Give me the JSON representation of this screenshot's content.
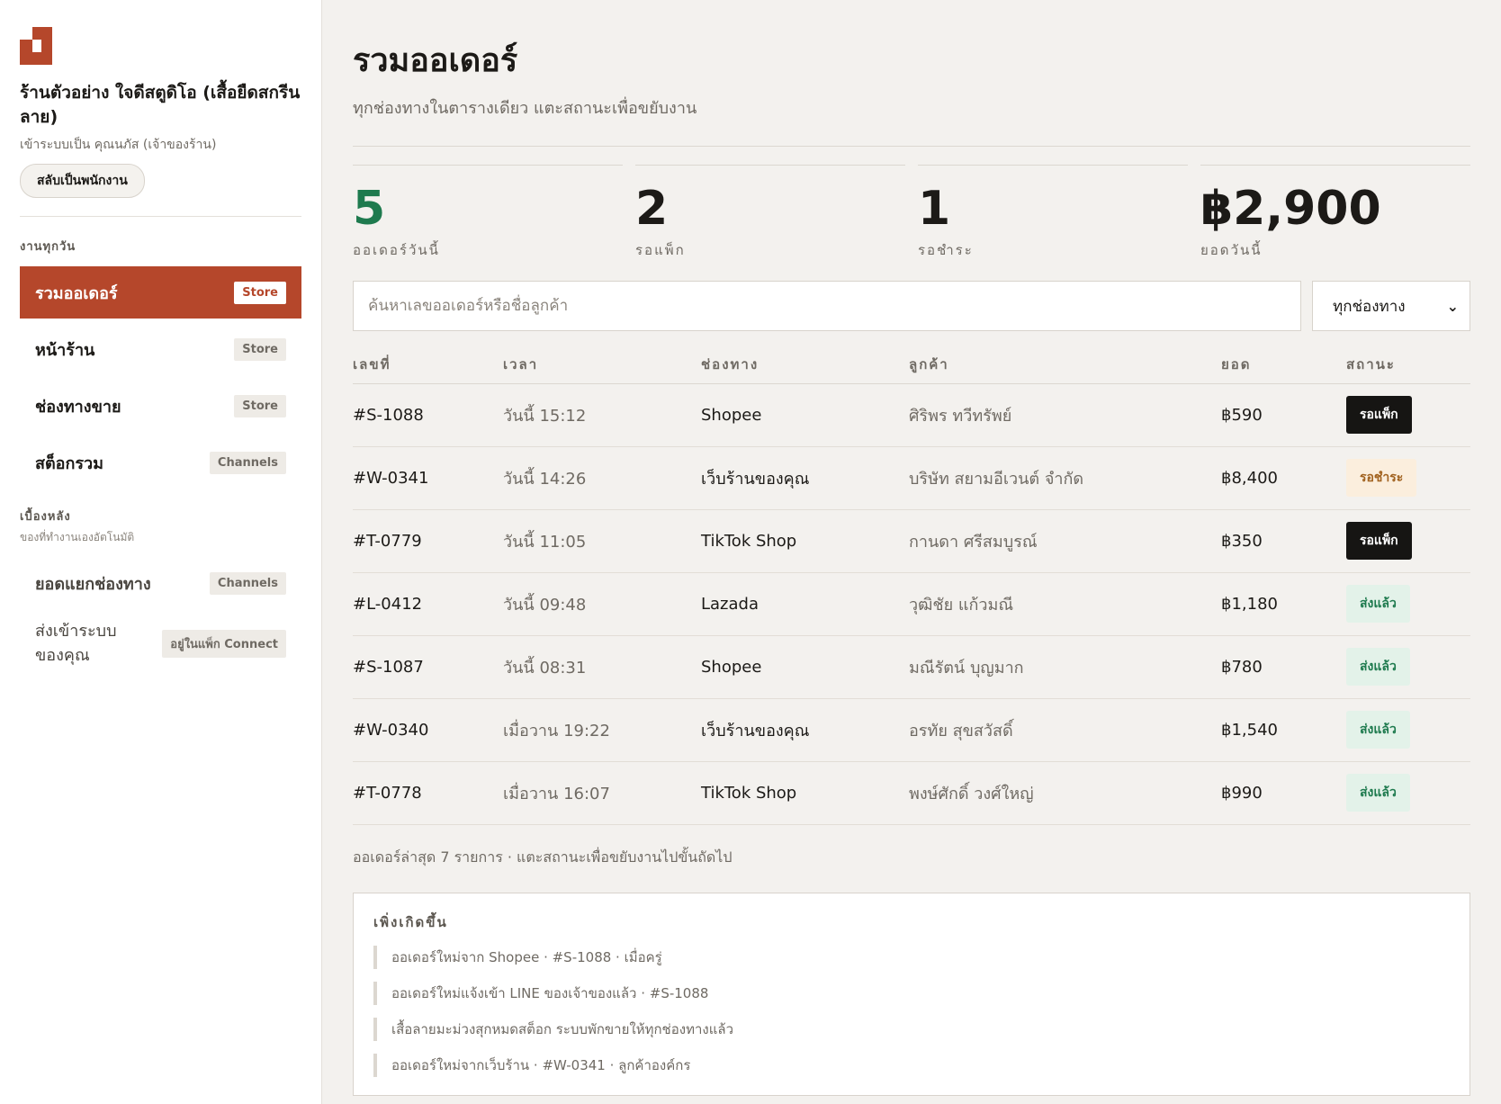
{
  "shop": {
    "name": "ร้านตัวอย่าง ใจดีสตูดิโอ (เสื้อยืดสกรีนลาย)",
    "login_as": "เข้าระบบเป็น คุณนภัส (เจ้าของร้าน)",
    "switch_label": "สลับเป็นพนักงาน"
  },
  "sidebar": {
    "section_daily": "งานทุกวัน",
    "daily_items": [
      {
        "label": "รวมออเดอร์",
        "tag": "Store"
      },
      {
        "label": "หน้าร้าน",
        "tag": "Store"
      },
      {
        "label": "ช่องทางขาย",
        "tag": "Store"
      },
      {
        "label": "สต็อกรวม",
        "tag": "Channels"
      }
    ],
    "section_back": "เบื้องหลัง",
    "section_back_sub": "ของที่ทำงานเองอัตโนมัติ",
    "back_items": [
      {
        "label": "ยอดแยกช่องทาง",
        "tag": "Channels"
      },
      {
        "label": "ส่งเข้าระบบของคุณ",
        "tag": "อยู่ในแพ็ก Connect"
      }
    ]
  },
  "header": {
    "title": "รวมออเดอร์",
    "subtitle": "ทุกช่องทางในตารางเดียว แตะสถานะเพื่อขยับงาน"
  },
  "stats": [
    {
      "value": "5",
      "label": "ออเดอร์วันนี้"
    },
    {
      "value": "2",
      "label": "รอแพ็ก"
    },
    {
      "value": "1",
      "label": "รอชำระ"
    },
    {
      "value": "฿2,900",
      "label": "ยอดวันนี้"
    }
  ],
  "search": {
    "placeholder": "ค้นหาเลขออเดอร์หรือชื่อลูกค้า",
    "channel_filter": "ทุกช่องทาง"
  },
  "table": {
    "headers": [
      "เลขที่",
      "เวลา",
      "ช่องทาง",
      "ลูกค้า",
      "ยอด",
      "สถานะ"
    ],
    "rows": [
      {
        "id": "#S-1088",
        "time": "วันนี้ 15:12",
        "channel": "Shopee",
        "customer": "ศิริพร ทวีทรัพย์",
        "amount": "฿590",
        "status": "รอแพ็ก"
      },
      {
        "id": "#W-0341",
        "time": "วันนี้ 14:26",
        "channel": "เว็บร้านของคุณ",
        "customer": "บริษัท สยามอีเวนต์ จำกัด",
        "amount": "฿8,400",
        "status": "รอชำระ"
      },
      {
        "id": "#T-0779",
        "time": "วันนี้ 11:05",
        "channel": "TikTok Shop",
        "customer": "กานดา ศรีสมบูรณ์",
        "amount": "฿350",
        "status": "รอแพ็ก"
      },
      {
        "id": "#L-0412",
        "time": "วันนี้ 09:48",
        "channel": "Lazada",
        "customer": "วุฒิชัย แก้วมณี",
        "amount": "฿1,180",
        "status": "ส่งแล้ว"
      },
      {
        "id": "#S-1087",
        "time": "วันนี้ 08:31",
        "channel": "Shopee",
        "customer": "มณีรัตน์ บุญมาก",
        "amount": "฿780",
        "status": "ส่งแล้ว"
      },
      {
        "id": "#W-0340",
        "time": "เมื่อวาน 19:22",
        "channel": "เว็บร้านของคุณ",
        "customer": "อรทัย สุขสวัสดิ์",
        "amount": "฿1,540",
        "status": "ส่งแล้ว"
      },
      {
        "id": "#T-0778",
        "time": "เมื่อวาน 16:07",
        "channel": "TikTok Shop",
        "customer": "พงษ์ศักดิ์ วงศ์ใหญ่",
        "amount": "฿990",
        "status": "ส่งแล้ว"
      }
    ],
    "footer": "ออเดอร์ล่าสุด 7 รายการ · แตะสถานะเพื่อขยับงานไปขั้นถัดไป"
  },
  "feed": {
    "title": "เพิ่งเกิดขึ้น",
    "items": [
      "ออเดอร์ใหม่จาก Shopee · #S-1088 · เมื่อครู่",
      "ออเดอร์ใหม่แจ้งเข้า LINE ของเจ้าของแล้ว · #S-1088",
      "เสื้อลายมะม่วงสุกหมดสต็อก ระบบพักขายให้ทุกช่องทางแล้ว",
      "ออเดอร์ใหม่จากเว็บร้าน · #W-0341 · ลูกค้าองค์กร"
    ]
  },
  "colors": {
    "accent": "#b5472b",
    "positive": "#1e7a4e",
    "pending_pay": "#a1621f",
    "dark_badge": "#161513"
  }
}
